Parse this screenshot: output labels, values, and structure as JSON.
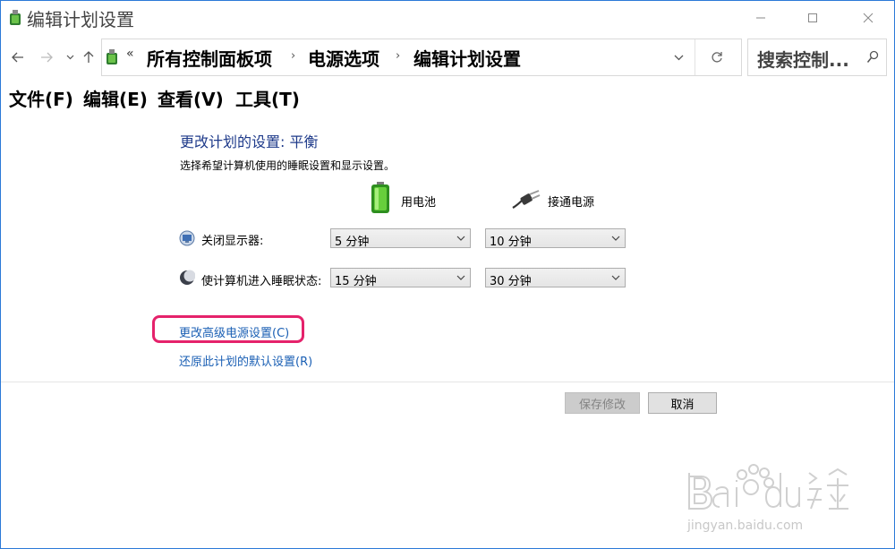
{
  "window": {
    "title": "编辑计划设置"
  },
  "address_bar": {
    "overflow": "«",
    "breadcrumbs": [
      "所有控制面板项",
      "电源选项",
      "编辑计划设置"
    ],
    "separator": "›"
  },
  "search": {
    "placeholder": "搜索控制..."
  },
  "menu": [
    "文件(F)",
    "编辑(E)",
    "查看(V)",
    "工具(T)"
  ],
  "content": {
    "heading": "更改计划的设置: 平衡",
    "description": "选择希望计算机使用的睡眠设置和显示设置。",
    "columns": {
      "battery": "用电池",
      "plugged": "接通电源"
    },
    "rows": [
      {
        "label": "关闭显示器:",
        "battery": "5 分钟",
        "plugged": "10 分钟"
      },
      {
        "label": "使计算机进入睡眠状态:",
        "battery": "15 分钟",
        "plugged": "30 分钟"
      }
    ],
    "links": {
      "advanced": "更改高级电源设置(C)",
      "restore": "还原此计划的默认设置(R)"
    }
  },
  "buttons": {
    "save": "保存修改",
    "cancel": "取消"
  },
  "watermark": {
    "url": "jingyan.baidu.com"
  },
  "colors": {
    "heading": "#1e3a8a",
    "link": "#1a5fb4",
    "highlight": "#e5226b",
    "window_border": "#2b79d7",
    "battery": "#3fae2a"
  }
}
